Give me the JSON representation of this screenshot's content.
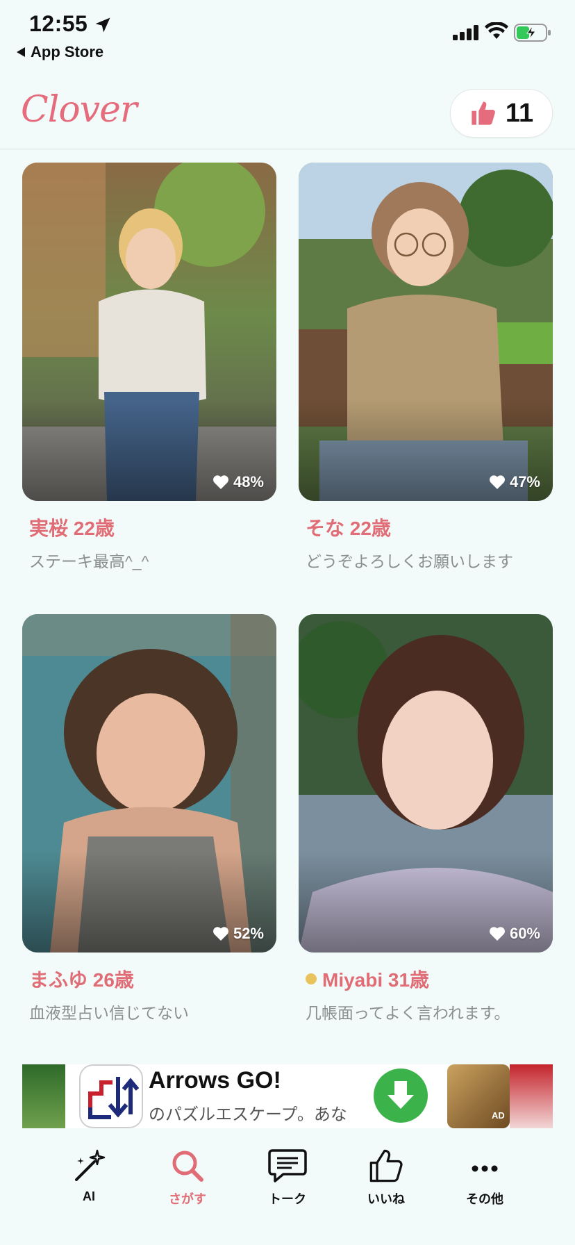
{
  "status_bar": {
    "time": "12:55",
    "back_label": "App Store"
  },
  "header": {
    "logo": "Clover",
    "like_count": "11"
  },
  "profiles": [
    {
      "name": "実桜 22歳",
      "bio": "ステーキ最高^_^",
      "match": "48%",
      "online": false
    },
    {
      "name": "そな 22歳",
      "bio": "どうぞよろしくお願いします",
      "match": "47%",
      "online": false
    },
    {
      "name": "まふゆ 26歳",
      "bio": "血液型占い信じてない",
      "match": "52%",
      "online": false
    },
    {
      "name": "Miyabi 31歳",
      "bio": "几帳面ってよく言われます。",
      "match": "60%",
      "online": true
    }
  ],
  "ad": {
    "title": "Arrows GO!",
    "subtitle": "のパズルエスケープ。あな",
    "badge": "AD"
  },
  "tabs": [
    {
      "label": "AI",
      "icon": "magic-wand-icon"
    },
    {
      "label": "さがす",
      "icon": "search-icon",
      "active": true
    },
    {
      "label": "トーク",
      "icon": "chat-bubble-icon"
    },
    {
      "label": "いいね",
      "icon": "thumbs-up-icon"
    },
    {
      "label": "その他",
      "icon": "more-dots-icon"
    }
  ],
  "colors": {
    "accent": "#e06d76",
    "background": "#f3fbfa",
    "online": "#e8c25a"
  }
}
